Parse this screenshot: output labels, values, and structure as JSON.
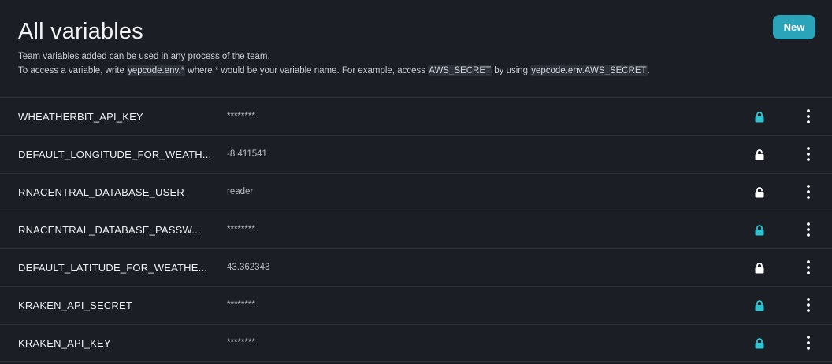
{
  "header": {
    "title": "All variables",
    "description_line1": "Team variables added can be used in any process of the team.",
    "description_line2_a": "To access a variable, write ",
    "description_line2_code1": "yepcode.env.*",
    "description_line2_b": " where * would be your variable name. For example, access ",
    "description_line2_code2": "AWS_SECRET",
    "description_line2_c": " by using ",
    "description_line2_code3": "yepcode.env.AWS_SECRET",
    "description_line2_d": ".",
    "new_button_label": "New"
  },
  "colors": {
    "accent": "#2aa4b8",
    "lock_secret": "#2ec4cf",
    "lock_open": "#ffffff",
    "background": "#1b1e25"
  },
  "variables": [
    {
      "name": "WHEATHERBIT_API_KEY",
      "value": "********",
      "secret": true,
      "lock_icon": "lock-closed-icon"
    },
    {
      "name": "DEFAULT_LONGITUDE_FOR_WEATH...",
      "value": "-8.411541",
      "secret": false,
      "lock_icon": "lock-open-icon"
    },
    {
      "name": "RNACENTRAL_DATABASE_USER",
      "value": "reader",
      "secret": false,
      "lock_icon": "lock-open-icon"
    },
    {
      "name": "RNACENTRAL_DATABASE_PASSW...",
      "value": "********",
      "secret": true,
      "lock_icon": "lock-closed-icon"
    },
    {
      "name": "DEFAULT_LATITUDE_FOR_WEATHE...",
      "value": "43.362343",
      "secret": false,
      "lock_icon": "lock-open-icon"
    },
    {
      "name": "KRAKEN_API_SECRET",
      "value": "********",
      "secret": true,
      "lock_icon": "lock-closed-icon"
    },
    {
      "name": "KRAKEN_API_KEY",
      "value": "********",
      "secret": true,
      "lock_icon": "lock-closed-icon"
    }
  ]
}
